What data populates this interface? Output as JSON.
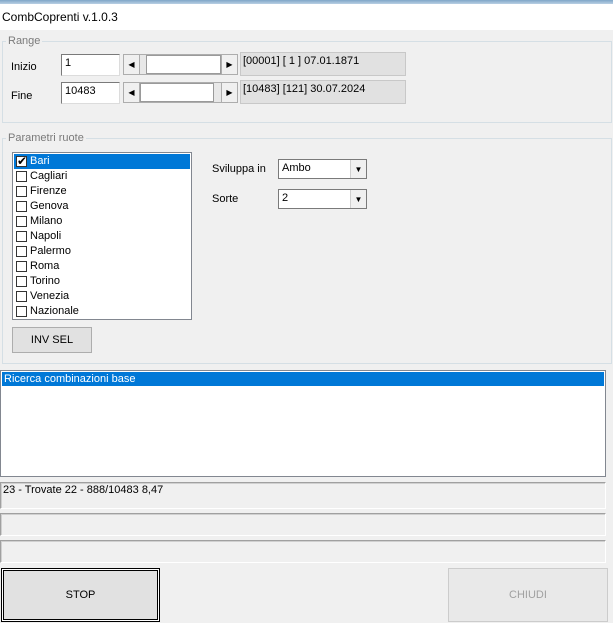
{
  "window": {
    "title": "CombCoprenti v.1.0.3"
  },
  "range": {
    "legend": "Range",
    "inizio": {
      "label": "Inizio",
      "value": "1",
      "info": "[00001] [ 1 ] 07.01.1871"
    },
    "fine": {
      "label": "Fine",
      "value": "10483",
      "info": "[10483] [121] 30.07.2024"
    }
  },
  "ruote": {
    "legend": "Parametri ruote",
    "items": [
      {
        "label": "Bari",
        "checked": true,
        "selected": true
      },
      {
        "label": "Cagliari",
        "checked": false
      },
      {
        "label": "Firenze",
        "checked": false
      },
      {
        "label": "Genova",
        "checked": false
      },
      {
        "label": "Milano",
        "checked": false
      },
      {
        "label": "Napoli",
        "checked": false
      },
      {
        "label": "Palermo",
        "checked": false
      },
      {
        "label": "Roma",
        "checked": false
      },
      {
        "label": "Torino",
        "checked": false
      },
      {
        "label": "Venezia",
        "checked": false
      },
      {
        "label": "Nazionale",
        "checked": false
      }
    ],
    "inv_sel_label": "INV SEL",
    "sviluppa": {
      "label": "Sviluppa in",
      "value": "Ambo"
    },
    "sorte": {
      "label": "Sorte",
      "value": "2"
    }
  },
  "log": {
    "selected_line": "Ricerca combinazioni base"
  },
  "status": {
    "line1": "23 - Trovate 22 - 888/10483 8,47",
    "line2": "",
    "line3": ""
  },
  "buttons": {
    "stop": "STOP",
    "chiudi": "CHIUDI"
  },
  "colors": {
    "selection": "#0078d7",
    "background": "#f0f0f0"
  }
}
